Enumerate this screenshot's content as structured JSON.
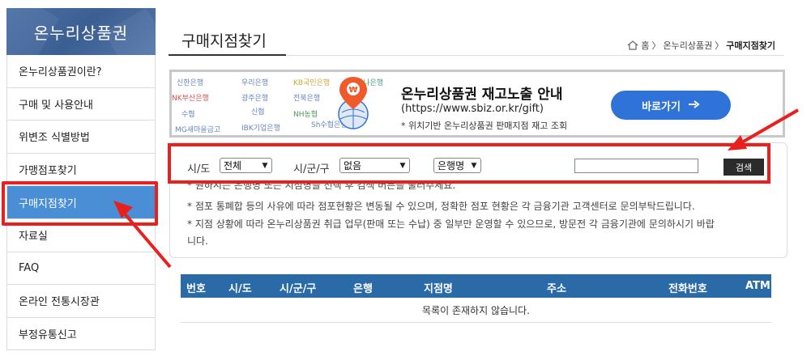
{
  "sidebar": {
    "title": "온누리상품권",
    "items": [
      {
        "label": "온누리상품권이란?"
      },
      {
        "label": "구매 및 사용안내"
      },
      {
        "label": "위변조 식별방법"
      },
      {
        "label": "가맹점포찾기"
      },
      {
        "label": "구매지점찾기",
        "active": true
      },
      {
        "label": "자료실"
      },
      {
        "label": "FAQ"
      },
      {
        "label": "온라인 전통시장관"
      },
      {
        "label": "부정유통신고"
      }
    ]
  },
  "page": {
    "title": "구매지점찾기",
    "breadcrumb": {
      "home": "홈",
      "section": "온누리상품권",
      "current": "구매지점찾기",
      "separator": "〉"
    }
  },
  "banner": {
    "bank_logos": [
      "신한은행",
      "우리은행",
      "KB국민은행",
      "하나은행",
      "NK부산은행",
      "광주은행",
      "전북은행",
      "수협",
      "신협",
      "NH농협",
      "MG새마을금고",
      "IBK기업은행",
      "Sh수협은행"
    ],
    "title": "온누리상품권 재고노출 안내",
    "url": "(https://www.sbiz.or.kr/gift)",
    "note": "* 위치기반 온누리상품권 판매지점 재고 조회",
    "button_label": "바로가기",
    "button_icon": "arrow-right-icon",
    "button_color": "#2f72d8"
  },
  "search": {
    "sido_label": "시/도",
    "sido_value": "전체",
    "sigungu_label": "시/군/구",
    "sigungu_value": "없음",
    "bank_value": "은행명",
    "keyword_value": "",
    "search_button": "검색",
    "notes": [
      "* 원하시는 은행명 또는 지점명을 선택 후 검색 버튼을 눌러주세요.",
      "* 점포 통폐합 등의 사유에 따라 점포현황은 변동될 수 있으며, 정확한 점포 현황은 각 금융기관 고객센터로 문의부탁드립니다.",
      "* 지점 상황에 따라 온누리상품권 취급 업무(판매 또는 수납) 중 일부만 운영할 수 있으므로, 방문전 각 금융기관에 문의하시기 바랍",
      "니다."
    ]
  },
  "table": {
    "columns": [
      "번호",
      "시/도",
      "시/군/구",
      "은행",
      "지점명",
      "주소",
      "전화번호",
      "ATM"
    ],
    "empty_message": "목록이 존재하지 않습니다.",
    "header_color": "#2a6aa6"
  },
  "annotations": {
    "highlight_color": "#e8201e"
  }
}
